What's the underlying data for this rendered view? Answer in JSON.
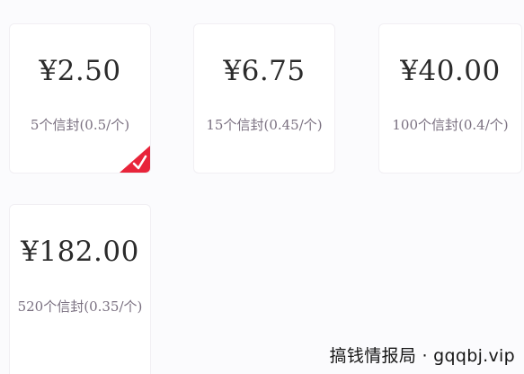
{
  "options": [
    {
      "price": "¥2.50",
      "desc": "5个信封(0.5/个)",
      "selected": true
    },
    {
      "price": "¥6.75",
      "desc": "15个信封(0.45/个)",
      "selected": false
    },
    {
      "price": "¥40.00",
      "desc": "100个信封(0.4/个)",
      "selected": false
    },
    {
      "price": "¥182.00",
      "desc": "520个信封(0.35/个)",
      "selected": false
    }
  ],
  "colors": {
    "accent": "#e8243a",
    "price_text": "#2b2b2b",
    "desc_text": "#7a7080",
    "card_border": "#f1eff3"
  },
  "icons": {
    "selected": "checkmark-icon"
  },
  "watermark": "搞钱情报局 · gqqbj.vip"
}
